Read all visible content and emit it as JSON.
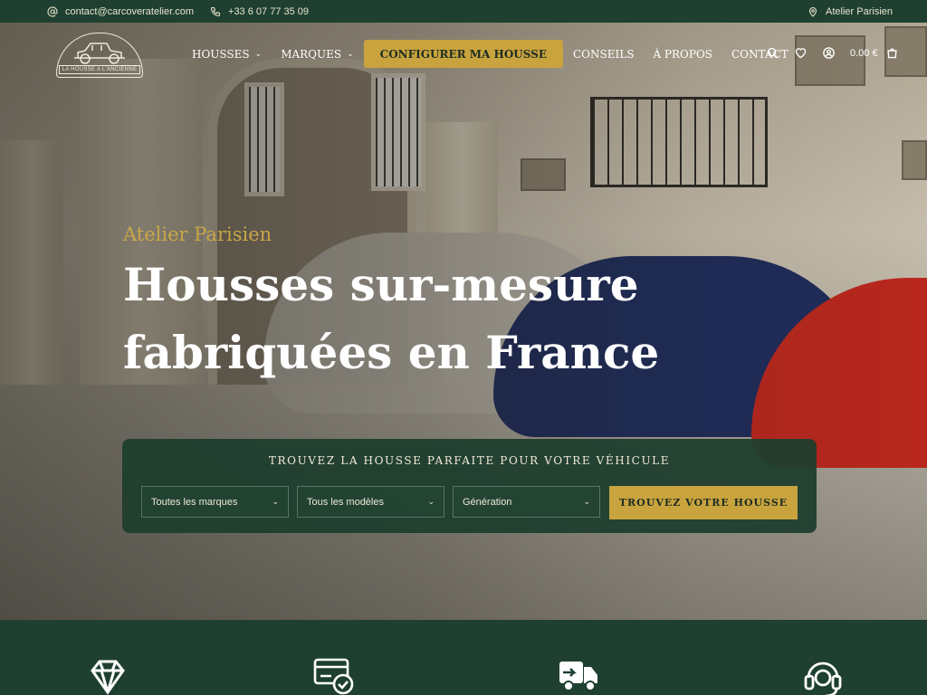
{
  "topbar": {
    "email": "contact@carcoveratelier.com",
    "phone": "+33 6 07 77 35 09",
    "location": "Atelier Parisien",
    "icons": [
      "at-icon",
      "phone-icon",
      "map-pin-icon"
    ]
  },
  "brand": {
    "logo_text": "LA HOUSSE A L'ANCIENNE"
  },
  "nav": {
    "items": [
      {
        "label": "HOUSSES",
        "has_dropdown": true
      },
      {
        "label": "MARQUES",
        "has_dropdown": true
      }
    ],
    "cta_label": "CONFIGURER MA HOUSSE",
    "links": [
      {
        "label": "CONSEILS"
      },
      {
        "label": "À PROPOS"
      },
      {
        "label": "CONTACT"
      }
    ],
    "cart_total": "0.00 €",
    "tool_icons": [
      "search-icon",
      "heart-icon",
      "user-icon",
      "cart-icon"
    ]
  },
  "hero": {
    "eyebrow": "Atelier Parisien",
    "headline_line1": "Housses sur-mesure",
    "headline_line2": "fabriquées en France"
  },
  "finder": {
    "title": "TROUVEZ LA HOUSSE PARFAITE POUR VOTRE VÉHICULE",
    "brand_select": "Toutes les marques",
    "model_select": "Tous les modèles",
    "generation_select": "Génération",
    "submit_label": "TROUVEZ VOTRE HOUSSE"
  },
  "features": {
    "icons": [
      "diamond-icon",
      "payment-card-icon",
      "delivery-truck-icon",
      "support-headset-icon"
    ]
  },
  "colors": {
    "dark_green": "#1f4030",
    "gold": "#c9a33e",
    "cream": "#f0ead8"
  }
}
